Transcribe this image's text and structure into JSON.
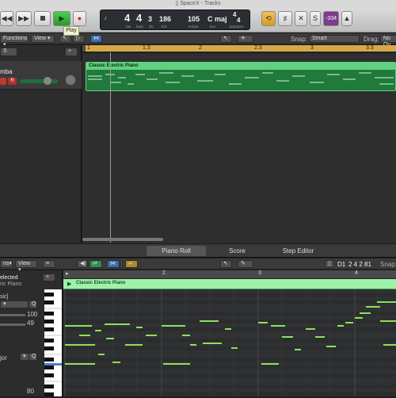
{
  "window_title": "SpaceX - Tracks",
  "toolbar": {
    "play_tooltip": "Play",
    "lcd": {
      "bar": "4",
      "beat": "4",
      "div": "3",
      "tick": "186",
      "tempo": "105",
      "key": "C maj",
      "time_sig_num": "4",
      "time_sig_den": "4",
      "labels": {
        "bar": "bar",
        "beat": "beat",
        "div": "div",
        "tick": "tick",
        "tempo": "tempo",
        "key": "key",
        "sig": "signature"
      }
    },
    "badge": "-334"
  },
  "tracks_header": {
    "functions_label": "Functions",
    "view_label": "View",
    "snap_label": "Snap:",
    "snap_value": "Smart",
    "drag_label": "Drag:",
    "drag_value": "No Ov"
  },
  "track": {
    "name": "mba",
    "solo": "S",
    "rec": "R"
  },
  "arrange_ruler": [
    "1",
    "1.3",
    "2",
    "2.3",
    "3",
    "3.3"
  ],
  "region": {
    "name": "Classic Electric Piano"
  },
  "bottom_tabs": [
    "Piano Roll",
    "Score",
    "Step Editor"
  ],
  "editor": {
    "functions_label": "ns",
    "view_label": "View",
    "position": "D1",
    "position_value": "2 4 2 81",
    "snap_label": "Snap:"
  },
  "inspector": {
    "selected_label": "elected",
    "sub_label": "ric Piano",
    "field1": "sic]",
    "q_label": "Q",
    "value1": "100",
    "value2": "49",
    "scale": "jor",
    "value3": "80"
  },
  "piano_roll": {
    "ruler": [
      "2",
      "3",
      "4"
    ],
    "region_name": "Classic Electric Piano"
  },
  "colors": {
    "accent_green": "#5fd17f",
    "cycle": "#d7a84a",
    "note": "#8fe05a"
  }
}
